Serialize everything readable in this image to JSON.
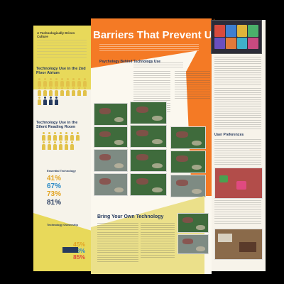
{
  "left_panel": {
    "intro_title": "A Technologically Driven Culture",
    "stat_header_1": "Technology Use in the 2nd Floor Atrium",
    "stat_header_2": "Technology Use in the Silent Reading Room",
    "essential_label": "Essential Technology",
    "essential_values": [
      "41%",
      "67%",
      "73%",
      "81%"
    ],
    "ownership_label": "Technology Ownership",
    "ownership_values": [
      "45%",
      "73%",
      "85%"
    ]
  },
  "main_panel": {
    "title": "Barriers That Prevent Use",
    "section_1": "Psychology Behind Technology Use",
    "section_2": "Bring Your Own Technology"
  },
  "right_panel": {
    "section": "User Preferences"
  },
  "colors": {
    "orange": "#f47a25",
    "yellow": "#e8d95a",
    "navy": "#263a5f",
    "teal": "#2b8ac6",
    "pct_gold": "#e2a424",
    "pct_red": "#e04a3c"
  }
}
